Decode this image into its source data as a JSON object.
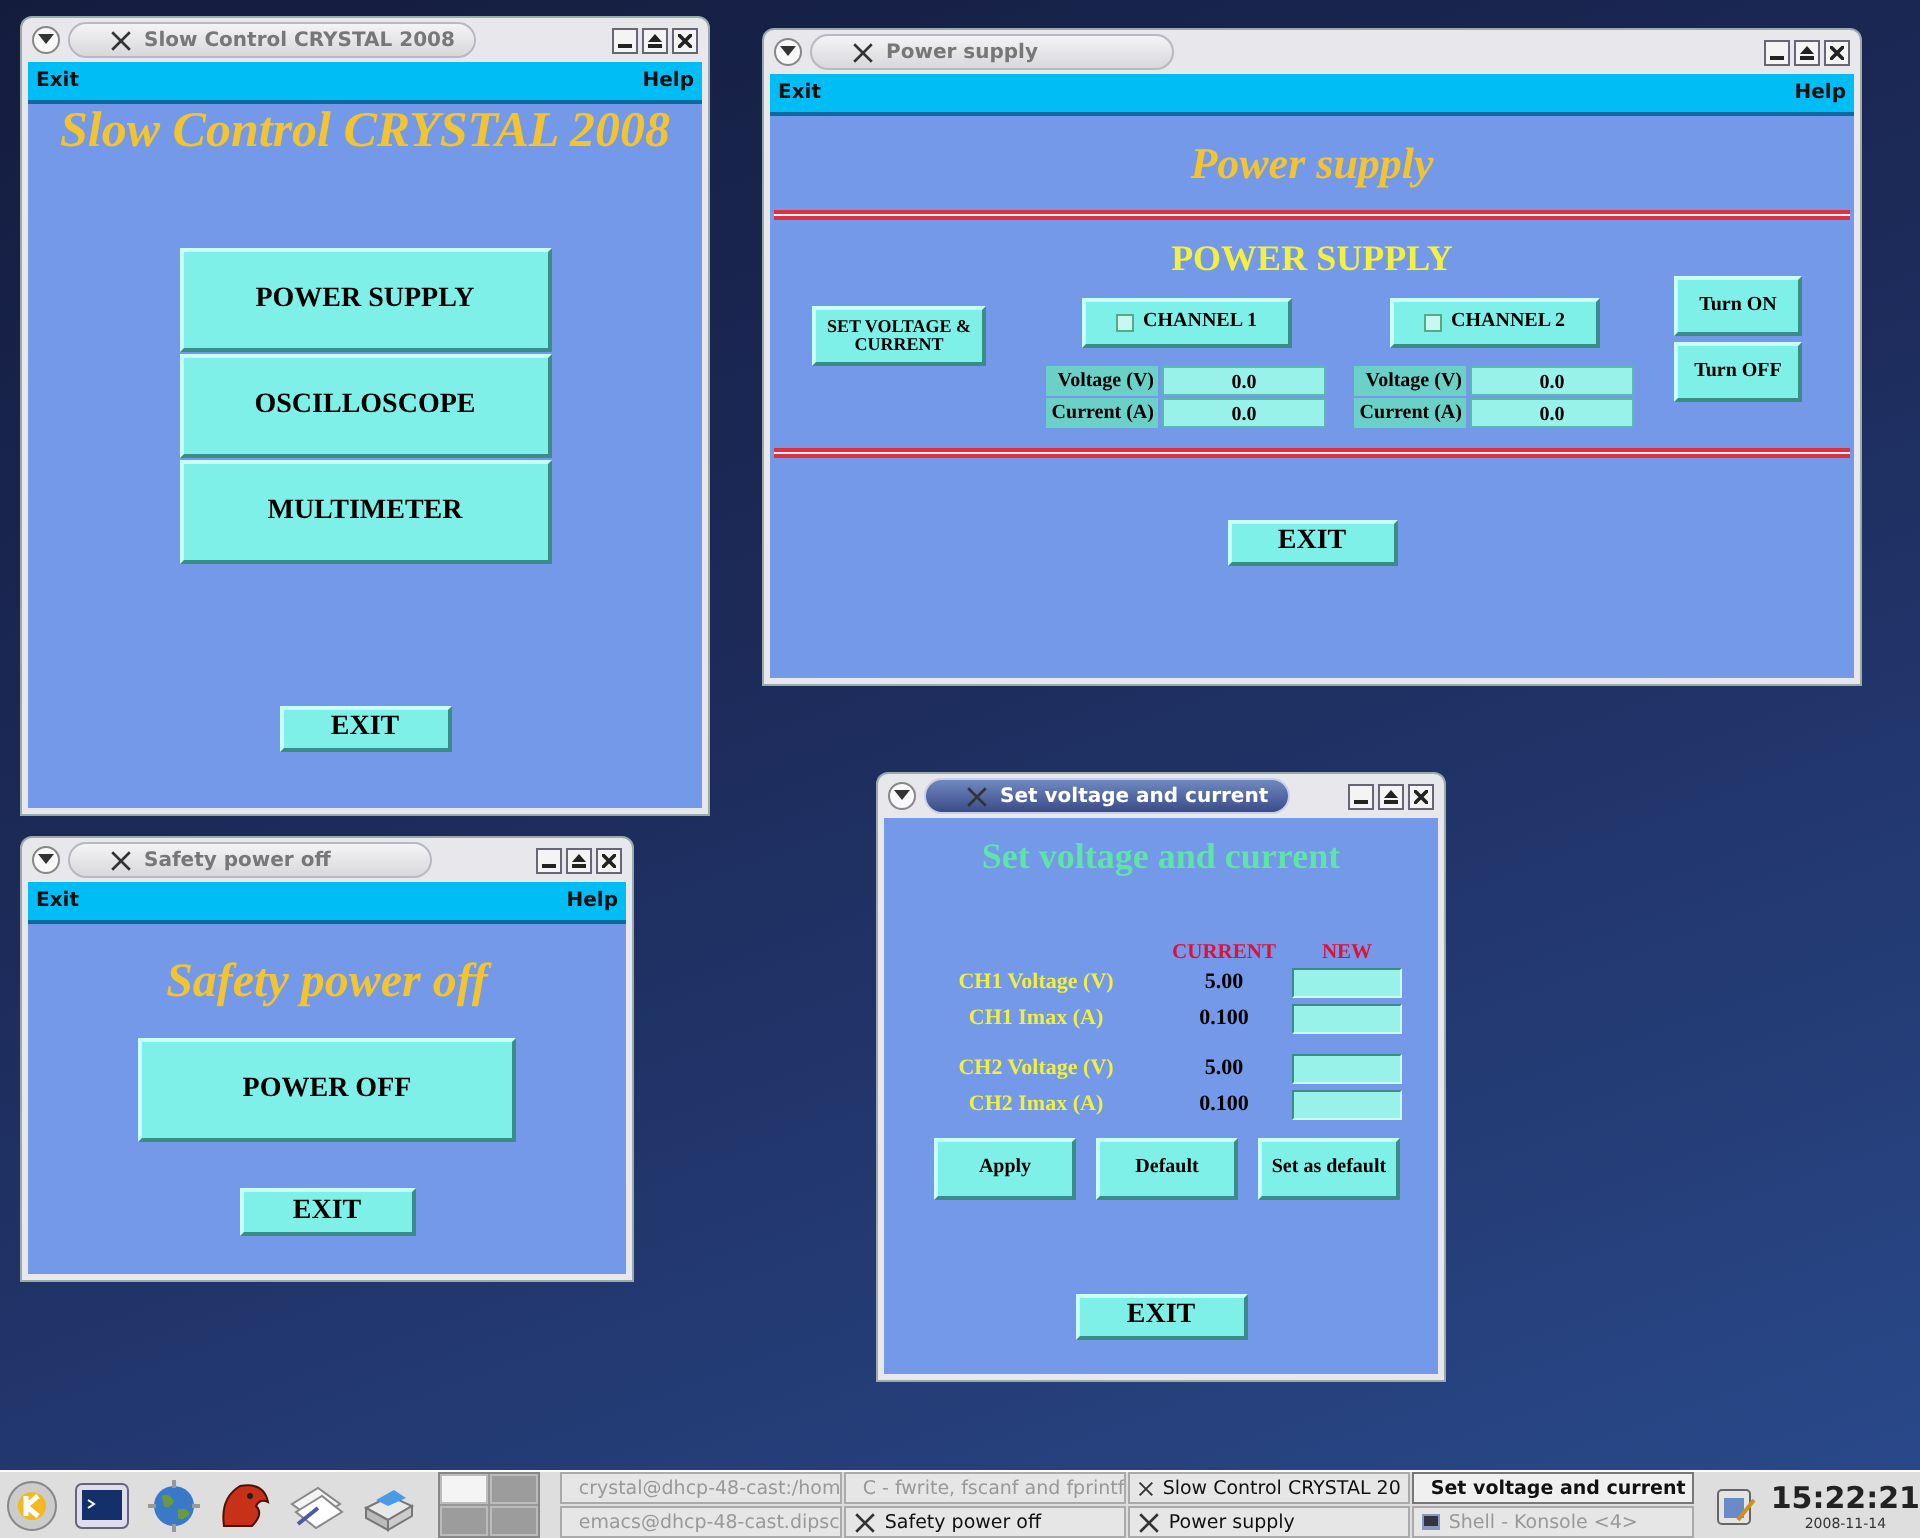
{
  "windows": [
    {
      "kind": "menu",
      "title": "Slow Control CRYSTAL 2008",
      "active": false,
      "menubar": {
        "left": "Exit",
        "right": "Help"
      },
      "heading": "Slow Control CRYSTAL 2008",
      "buttons": [
        "POWER SUPPLY",
        "OSCILLOSCOPE",
        "MULTIMETER"
      ],
      "exit_button": "EXIT"
    },
    {
      "kind": "power_supply",
      "title": "Power supply",
      "active": false,
      "menubar": {
        "left": "Exit",
        "right": "Help"
      },
      "heading": "Power supply",
      "section_title": "POWER SUPPLY",
      "set_button": "SET VOLTAGE & CURRENT",
      "channels": [
        {
          "label": "CHANNEL 1",
          "checked": false,
          "readings": [
            {
              "label": "Voltage (V)",
              "value": "0.0"
            },
            {
              "label": "Current (A)",
              "value": "0.0"
            }
          ]
        },
        {
          "label": "CHANNEL 2",
          "checked": false,
          "readings": [
            {
              "label": "Voltage (V)",
              "value": "0.0"
            },
            {
              "label": "Current (A)",
              "value": "0.0"
            }
          ]
        }
      ],
      "power_buttons": [
        "Turn ON",
        "Turn OFF"
      ],
      "exit_button": "EXIT"
    },
    {
      "kind": "safety",
      "title": "Safety power off",
      "active": false,
      "menubar": {
        "left": "Exit",
        "right": "Help"
      },
      "heading": "Safety power off",
      "buttons": [
        "POWER OFF"
      ],
      "exit_button": "EXIT"
    },
    {
      "kind": "set_values",
      "title": "Set voltage and current",
      "active": true,
      "heading": "Set voltage and current",
      "columns": [
        "CURRENT",
        "NEW"
      ],
      "groups": [
        [
          {
            "label": "CH1 Voltage (V)",
            "current": "5.00"
          },
          {
            "label": "CH1 Imax (A)",
            "current": "0.100"
          }
        ],
        [
          {
            "label": "CH2 Voltage (V)",
            "current": "5.00"
          },
          {
            "label": "CH2 Imax (A)",
            "current": "0.100"
          }
        ]
      ],
      "buttons": [
        "Apply",
        "Default",
        "Set as default"
      ],
      "exit_button": "EXIT"
    }
  ],
  "taskbar": {
    "pager": [
      {
        "selected": true
      },
      {
        "selected": false
      },
      {
        "selected": false
      },
      {
        "selected": false
      }
    ],
    "tasks": [
      {
        "label": "crystal@dhcp-48-cast:/hom",
        "kind": "terminal",
        "active": false,
        "dimmed": true
      },
      {
        "label": "C - fwrite, fscanf and fprintf",
        "kind": "document",
        "active": false,
        "dimmed": true
      },
      {
        "label": "Slow Control CRYSTAL 20",
        "kind": "x",
        "active": false,
        "dimmed": false
      },
      {
        "label": "Set voltage and current",
        "kind": "x",
        "active": true,
        "dimmed": false
      },
      {
        "label": "emacs@dhcp-48-cast.dipsc",
        "kind": "editor",
        "active": false,
        "dimmed": true
      },
      {
        "label": "Safety power off",
        "kind": "x",
        "active": false,
        "dimmed": false
      },
      {
        "label": "Power supply",
        "kind": "x",
        "active": false,
        "dimmed": false
      },
      {
        "label": "Shell - Konsole <4>",
        "kind": "terminal",
        "active": false,
        "dimmed": true
      }
    ],
    "clock": {
      "time": "15:22:21",
      "date": "2008-11-14"
    }
  }
}
